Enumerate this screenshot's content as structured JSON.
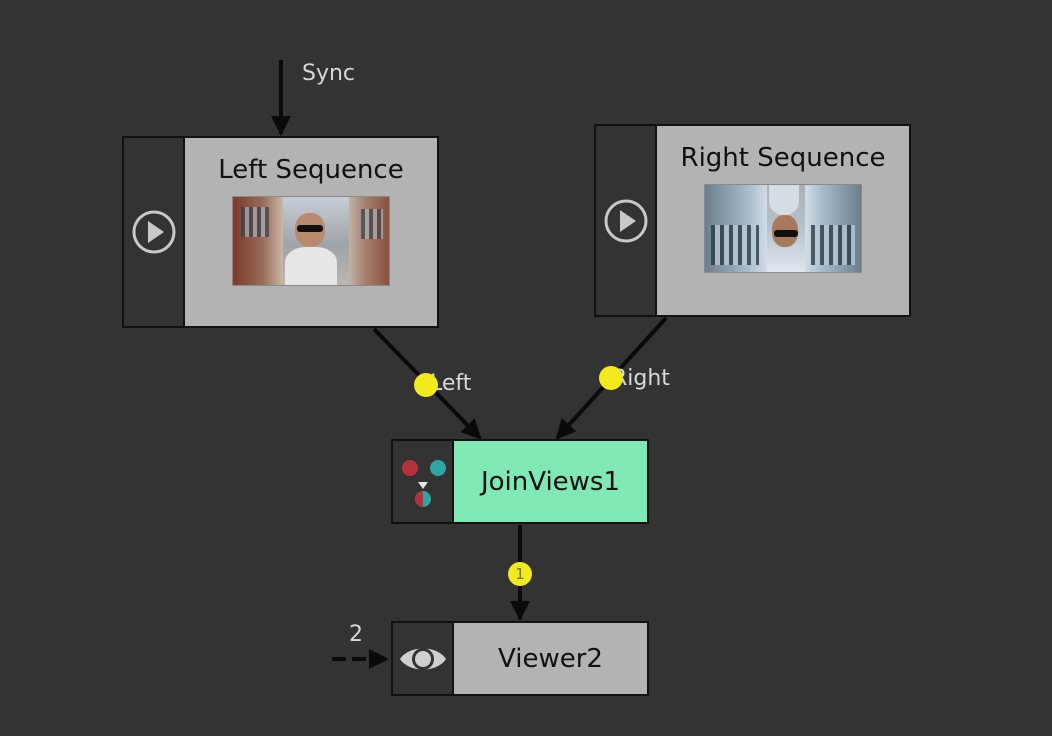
{
  "edges": {
    "sync_label": "Sync",
    "left_label": "Left",
    "right_label": "Right",
    "join_to_viewer_label": "1",
    "viewer_input_label": "2"
  },
  "nodes": {
    "left_sequence": {
      "title": "Left Sequence",
      "icon": "play-icon"
    },
    "right_sequence": {
      "title": "Right Sequence",
      "icon": "play-icon"
    },
    "join_views": {
      "title": "JoinViews1",
      "icon": "join-views-icon"
    },
    "viewer": {
      "title": "Viewer2",
      "icon": "eye-icon"
    }
  },
  "colors": {
    "canvas": "#333333",
    "node_body": "#b3b3b3",
    "join_node_body": "#7fe8b5",
    "edge": "#0a0a0a",
    "port_dot": "#f2ea1c",
    "label_text": "#d8d8d8"
  }
}
